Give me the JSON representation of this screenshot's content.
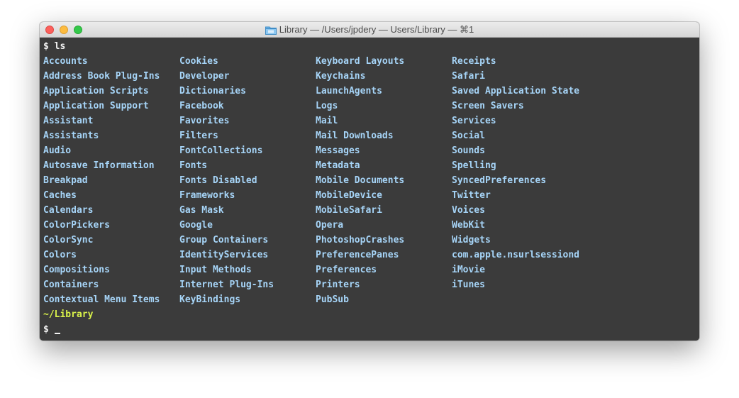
{
  "window": {
    "title": "Library — /Users/jpdery — Users/Library — ⌘1",
    "title_icon": "folder-icon"
  },
  "terminal": {
    "prompt_symbol": "$",
    "command": "ls",
    "columns": [
      [
        "Accounts",
        "Address Book Plug-Ins",
        "Application Scripts",
        "Application Support",
        "Assistant",
        "Assistants",
        "Audio",
        "Autosave Information",
        "Breakpad",
        "Caches",
        "Calendars",
        "ColorPickers",
        "ColorSync",
        "Colors",
        "Compositions",
        "Containers",
        "Contextual Menu Items"
      ],
      [
        "Cookies",
        "Developer",
        "Dictionaries",
        "Facebook",
        "Favorites",
        "Filters",
        "FontCollections",
        "Fonts",
        "Fonts Disabled",
        "Frameworks",
        "Gas Mask",
        "Google",
        "Group Containers",
        "IdentityServices",
        "Input Methods",
        "Internet Plug-Ins",
        "KeyBindings"
      ],
      [
        "Keyboard Layouts",
        "Keychains",
        "LaunchAgents",
        "Logs",
        "Mail",
        "Mail Downloads",
        "Messages",
        "Metadata",
        "Mobile Documents",
        "MobileDevice",
        "MobileSafari",
        "Opera",
        "PhotoshopCrashes",
        "PreferencePanes",
        "Preferences",
        "Printers",
        "PubSub"
      ],
      [
        "Receipts",
        "Safari",
        "Saved Application State",
        "Screen Savers",
        "Services",
        "Social",
        "Sounds",
        "Spelling",
        "SyncedPreferences",
        "Twitter",
        "Voices",
        "WebKit",
        "Widgets",
        "com.apple.nsurlsessiond",
        "iMovie",
        "iTunes"
      ]
    ],
    "current_path": "~/Library",
    "cursor_char": "_"
  },
  "colors": {
    "terminal_bg": "#3b3b3b",
    "foreground": "#f2f2f2",
    "directory": "#a6d4f7",
    "path": "#d9f24a",
    "close": "#fc605c",
    "minimize": "#fdbc40",
    "zoom": "#34c84a"
  }
}
